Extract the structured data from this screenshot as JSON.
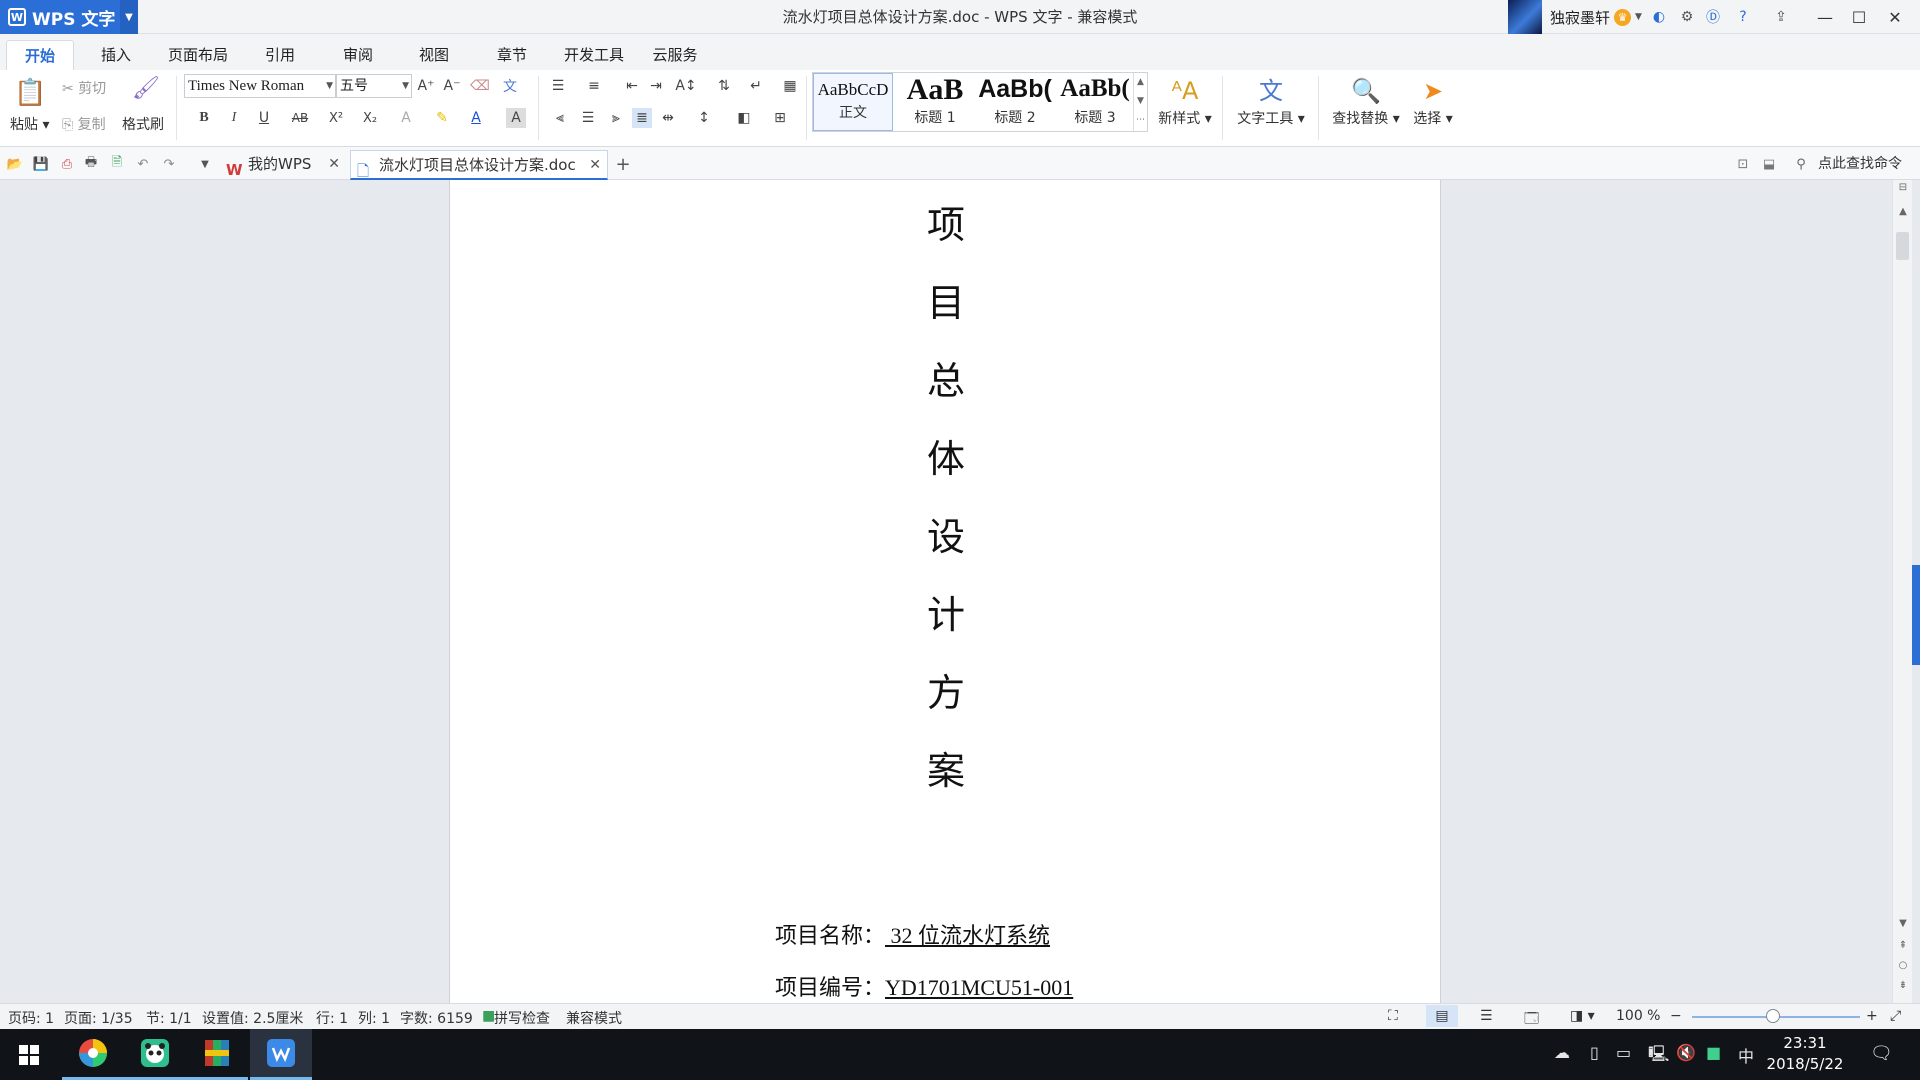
{
  "app": {
    "menu_label": "WPS 文字",
    "window_title": "流水灯项目总体设计方案.doc - WPS 文字 - 兼容模式",
    "user_name": "独寂墨轩"
  },
  "ribbon_tabs": [
    "开始",
    "插入",
    "页面布局",
    "引用",
    "审阅",
    "视图",
    "章节",
    "开发工具",
    "云服务"
  ],
  "ribbon": {
    "paste_label": "粘贴",
    "cut_label": "剪切",
    "copy_label": "复制",
    "format_painter_label": "格式刷",
    "font_name": "Times New Roman",
    "font_size": "五号",
    "styles": [
      {
        "sample": "AaBbCcD",
        "label": "正文"
      },
      {
        "sample": "AaB",
        "label": "标题 1"
      },
      {
        "sample": "AaBb(",
        "label": "标题 2"
      },
      {
        "sample": "AaBb(",
        "label": "标题 3"
      }
    ],
    "new_style_label": "新样式",
    "text_tools_label": "文字工具",
    "find_replace_label": "查找替换",
    "select_label": "选择",
    "command_search": "点此查找命令"
  },
  "doc_tabs": [
    {
      "label": "我的WPS"
    },
    {
      "label": "流水灯项目总体设计方案.doc"
    }
  ],
  "document": {
    "title_chars": [
      "项",
      "目",
      "总",
      "体",
      "设",
      "计",
      "方",
      "案"
    ],
    "fields": [
      {
        "label": "项目名称：",
        "value": " 32 位流水灯系统"
      },
      {
        "label": "项目编号：",
        "value": "YD1701MCU51-001"
      }
    ]
  },
  "status": {
    "page_code": "页码: 1",
    "pages": "页面: 1/35",
    "section": "节: 1/1",
    "setting": "设置值: 2.5厘米",
    "row": "行: 1",
    "col": "列: 1",
    "words": "字数: 6159",
    "spell_check": "拼写检查",
    "compat": "兼容模式",
    "zoom": "100 %"
  },
  "taskbar": {
    "time": "23:31",
    "date": "2018/5/22",
    "ime": "中"
  },
  "colors": {
    "accent": "#2b6fd6",
    "taskbar": "#101418"
  }
}
